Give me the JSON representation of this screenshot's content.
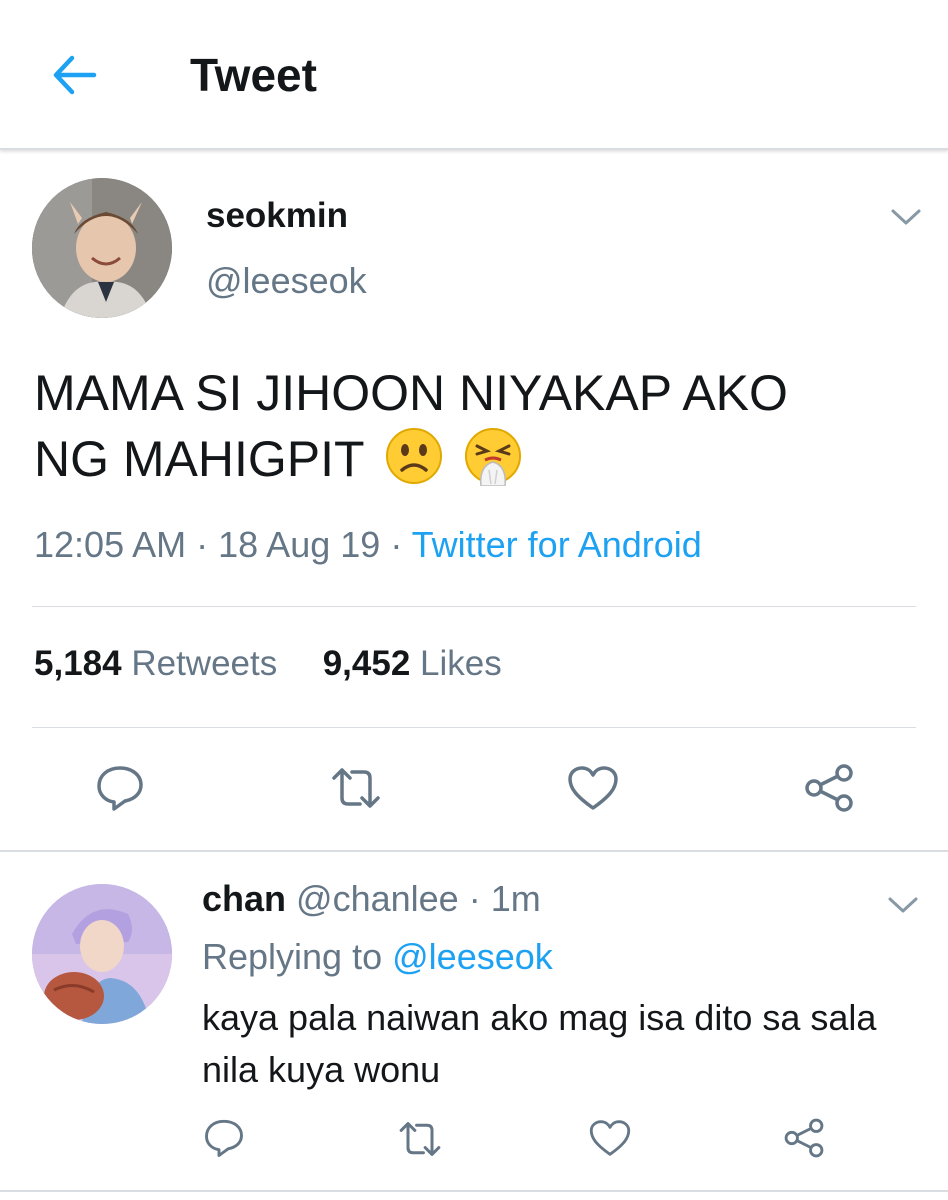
{
  "header": {
    "title": "Tweet",
    "back_icon": "arrow-left-icon",
    "accent_color": "#1da1f2"
  },
  "tweet": {
    "author": {
      "display_name": "seokmin",
      "handle": "@leeseok"
    },
    "text_line1": "MAMA SI JIHOON NIYAKAP AKO",
    "text_line2": "NG MAHIGPIT",
    "emojis": [
      "frowning-face-emoji",
      "sneezing-face-emoji"
    ],
    "time": "12:05 AM",
    "date": "18 Aug 19",
    "source": "Twitter for Android",
    "stats": {
      "retweets_count": "5,184",
      "retweets_label": "Retweets",
      "likes_count": "9,452",
      "likes_label": "Likes"
    },
    "actions": [
      "reply-icon",
      "retweet-icon",
      "like-icon",
      "share-icon"
    ]
  },
  "reply": {
    "display_name": "chan",
    "handle": "@chanlee",
    "age": "1m",
    "replying_prefix": "Replying to",
    "replying_to": "@leeseok",
    "text": "kaya pala naiwan ako mag isa dito sa sala nila kuya wonu",
    "actions": [
      "reply-icon",
      "retweet-icon",
      "like-icon",
      "share-icon"
    ]
  },
  "colors": {
    "text_primary": "#14171a",
    "text_secondary": "#657786",
    "link": "#1da1f2",
    "divider": "#d9dde1"
  }
}
